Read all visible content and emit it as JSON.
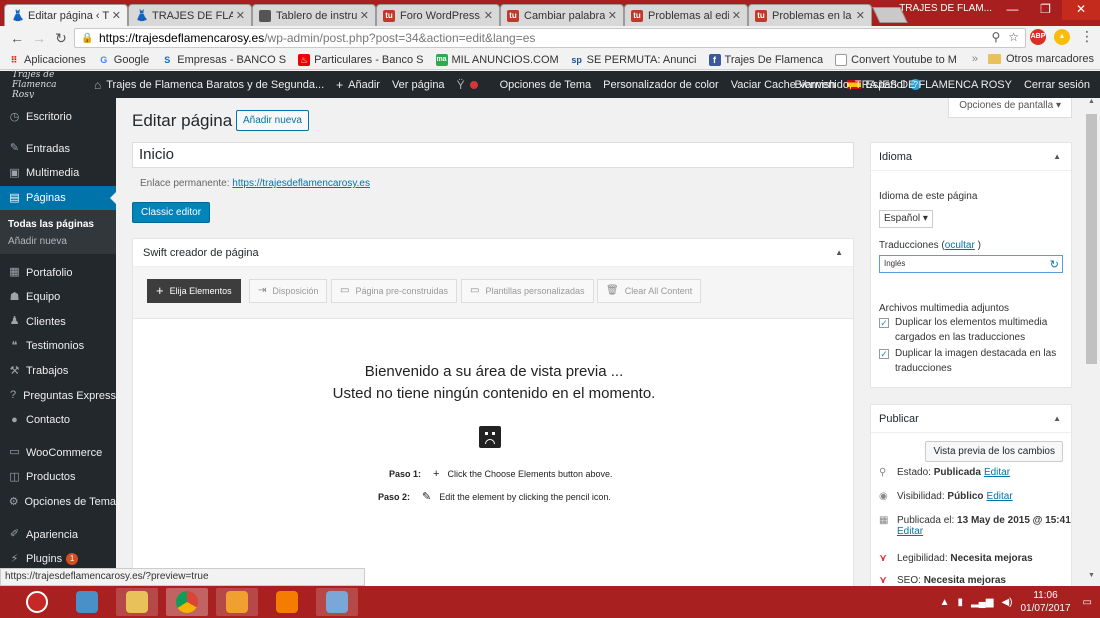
{
  "browser": {
    "tabs": [
      {
        "label": "Editar página ‹ Tr",
        "active": true
      },
      {
        "label": "TRAJES DE FLAME",
        "active": false
      },
      {
        "label": "Tablero de instruc",
        "active": false
      },
      {
        "label": "Foro WordPress.",
        "active": false
      },
      {
        "label": "Cambiar palabras",
        "active": false
      },
      {
        "label": "Problemas al edit",
        "active": false
      },
      {
        "label": "Problemas en la p",
        "active": false
      }
    ],
    "window_title": "TRAJES DE FLAM...",
    "url_host": "https://trajesdeflamencarosy.es",
    "url_rest": "/wp-admin/post.php?post=34&action=edit&lang=es",
    "bookmarks": [
      {
        "label": "Aplicaciones",
        "icon": "apps-grid-icon"
      },
      {
        "label": "Google",
        "icon": "google-icon"
      },
      {
        "label": "Empresas - BANCO S",
        "icon": "bank-icon"
      },
      {
        "label": "Particulares - Banco S",
        "icon": "santander-icon"
      },
      {
        "label": "MIL ANUNCIOS.COM",
        "icon": "milanuncios-icon"
      },
      {
        "label": "SE PERMUTA: Anunci",
        "icon": "sp-icon"
      },
      {
        "label": "Trajes De Flamenca",
        "icon": "facebook-icon"
      },
      {
        "label": "Convert Youtube to M",
        "icon": "page-icon"
      }
    ],
    "other_bookmarks": "Otros marcadores",
    "status_url": "https://trajesdeflamencarosy.es/?preview=true"
  },
  "adminbar": {
    "logo_text": "Trajes de Flamenca Rosy",
    "site_name": "Trajes de Flamenca Baratos y de Segunda...",
    "add": "Añadir",
    "view_page": "Ver página",
    "theme_options": "Opciones de Tema",
    "color_customizer": "Personalizador de color",
    "varnish": "Vaciar Cache Varnish",
    "language": "Español",
    "welcome": "Bienvenido, TRAJES DE FLAMENCA ROSY",
    "logout": "Cerrar sesión"
  },
  "sidebar": {
    "items": [
      {
        "label": "Escritorio",
        "icon": "dashboard-icon"
      },
      {
        "label": "Entradas",
        "icon": "pin-icon"
      },
      {
        "label": "Multimedia",
        "icon": "media-icon"
      },
      {
        "label": "Páginas",
        "icon": "pages-icon"
      }
    ],
    "sub_items": [
      "Todas las páginas",
      "Añadir nueva"
    ],
    "items2": [
      {
        "label": "Portafolio",
        "icon": "portfolio-icon"
      },
      {
        "label": "Equipo",
        "icon": "team-icon"
      },
      {
        "label": "Clientes",
        "icon": "clients-icon"
      },
      {
        "label": "Testimonios",
        "icon": "quote-icon"
      },
      {
        "label": "Trabajos",
        "icon": "hammer-icon"
      },
      {
        "label": "Preguntas Express",
        "icon": "question-icon"
      },
      {
        "label": "Contacto",
        "icon": "contact-icon"
      }
    ],
    "items3": [
      {
        "label": "WooCommerce",
        "icon": "woo-icon"
      },
      {
        "label": "Productos",
        "icon": "products-icon"
      },
      {
        "label": "Opciones de Tema",
        "icon": "gear-icon"
      }
    ],
    "items4": [
      {
        "label": "Apariencia",
        "icon": "brush-icon"
      },
      {
        "label": "Plugins",
        "icon": "plugin-icon",
        "badge": "1"
      }
    ]
  },
  "editor": {
    "screen_options": "Opciones de pantalla",
    "title": "Editar página",
    "add_new": "Añadir nueva",
    "post_title": "Inicio",
    "permalink_label": "Enlace permanente:",
    "permalink_url": "https://trajesdeflamencarosy.es",
    "classic_editor": "Classic editor"
  },
  "swift": {
    "header": "Swift creador de página",
    "toolbar": {
      "choose": "Elija Elementos",
      "layout": "Disposición",
      "prebuilt": "Página pre-construidas",
      "templates": "Plantillas personalizadas",
      "clear": "Clear All Content"
    },
    "welcome_line1": "Bienvenido a su área de vista previa ...",
    "welcome_line2": "Usted no tiene ningún contenido en el momento.",
    "step1_label": "Paso 1:",
    "step1_text": "Click the Choose Elements button above.",
    "step2_label": "Paso 2:",
    "step2_text": "Edit the element by clicking the pencil icon."
  },
  "idioma": {
    "header": "Idioma",
    "page_language_label": "Idioma de este página",
    "selected_language": "Español",
    "translations_label": "Traducciones (",
    "translations_hide": "ocultar",
    "translations_close": " )",
    "translation_value": "Inglés",
    "media_label": "Archivos multimedia adjuntos",
    "check1": "Duplicar los elementos multimedia cargados en las traducciones",
    "check2": "Duplicar la imagen destacada en las traducciones"
  },
  "publish": {
    "header": "Publicar",
    "preview_changes": "Vista previa de los cambios",
    "status_label": "Estado:",
    "status_value": "Publicada",
    "visibility_label": "Visibilidad:",
    "visibility_value": "Público",
    "published_label": "Publicada el:",
    "published_value": "13 May de 2015 @ 15:41",
    "edit": "Editar",
    "readability_label": "Legibilidad:",
    "readability_value": "Necesita mejoras",
    "seo_label": "SEO:",
    "seo_value": "Necesita mejoras"
  },
  "taskbar": {
    "time": "11:06",
    "date": "01/07/2017"
  }
}
